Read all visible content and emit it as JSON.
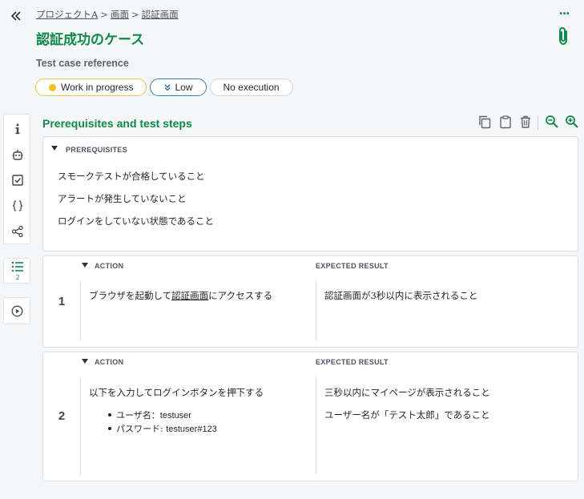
{
  "breadcrumb": {
    "items": [
      "プロジェクトA",
      "画面",
      "認証画面"
    ],
    "separator": ">"
  },
  "title": "認証成功のケース",
  "more_label": "...",
  "reference_label": "Test case reference",
  "chips": {
    "status": "Work in progress",
    "priority": "Low",
    "execution": "No execution"
  },
  "section": {
    "title": "Prerequisites and test steps"
  },
  "prerequisites": {
    "header": "PREREQUISITES",
    "lines": [
      "スモークテストが合格していること",
      "アラートが発生していないこと",
      "ログインをしていない状態であること"
    ]
  },
  "steps_count": "2",
  "steps": [
    {
      "number": "1",
      "action_header": "ACTION",
      "expected_header": "EXPECTED RESULT",
      "action_prefix": "ブラウザを起動して",
      "action_link": "認証画面",
      "action_suffix": "にアクセスする",
      "expected": [
        "認証画面が3秒以内に表示されること"
      ]
    },
    {
      "number": "2",
      "action_header": "ACTION",
      "expected_header": "EXPECTED RESULT",
      "action_text": "以下を入力してログインボタンを押下する",
      "bullets": [
        {
          "label": "ユーザ名：",
          "value": "testuser"
        },
        {
          "label": "パスワード: ",
          "value": "testuser#123"
        }
      ],
      "expected": [
        "三秒以内にマイページが表示されること",
        "ユーザー名が「テスト太郎」であること"
      ]
    }
  ],
  "colors": {
    "accent": "#0f8a4a",
    "status_dot": "#f2c018",
    "priority_border": "#3b7bb3"
  }
}
